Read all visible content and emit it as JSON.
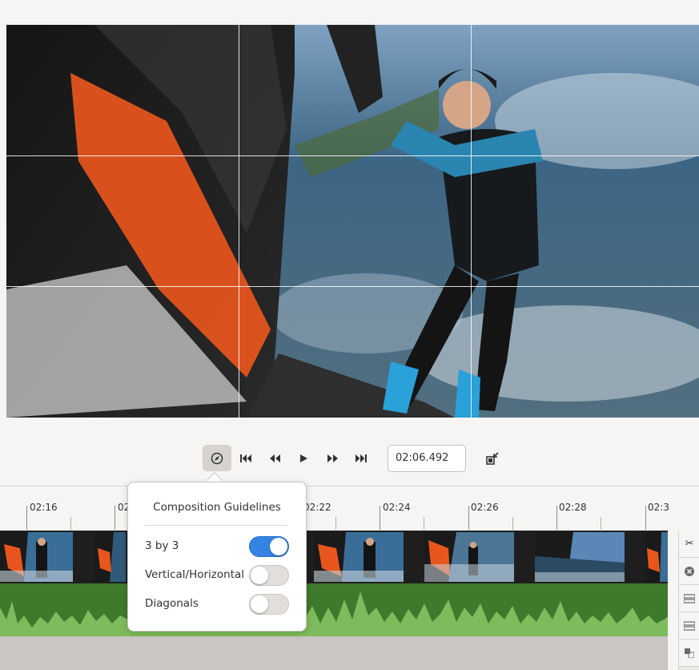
{
  "viewer": {
    "guidelines": {
      "three_by_three": true
    },
    "scene_description_icon": "video-frame"
  },
  "transport": {
    "composition_icon": "compass-icon",
    "buttons": [
      {
        "name": "go-to-start-button",
        "icon": "skip-start-icon"
      },
      {
        "name": "rewind-button",
        "icon": "rewind-icon"
      },
      {
        "name": "play-button",
        "icon": "play-icon"
      },
      {
        "name": "forward-button",
        "icon": "fast-forward-icon"
      },
      {
        "name": "go-to-end-button",
        "icon": "skip-end-icon"
      }
    ],
    "timecode": "02:06.492",
    "fullscreen_icon": "exit-fullscreen-icon"
  },
  "timeline": {
    "ticks": [
      "02:16",
      "02",
      "02:22",
      "02:24",
      "02:26",
      "02:28",
      "02:3"
    ],
    "side_tools": [
      "split-icon",
      "remove-icon",
      "align-icon",
      "align-icon",
      "snap-icon"
    ]
  },
  "popover": {
    "title": "Composition Guidelines",
    "options": [
      {
        "label": "3 by 3",
        "enabled": true
      },
      {
        "label": "Vertical/Horizontal",
        "enabled": false
      },
      {
        "label": "Diagonals",
        "enabled": false
      }
    ]
  },
  "colors": {
    "accent": "#3584e4",
    "audio_track": "#3e7a2c",
    "waveform": "#7dbb5c"
  }
}
